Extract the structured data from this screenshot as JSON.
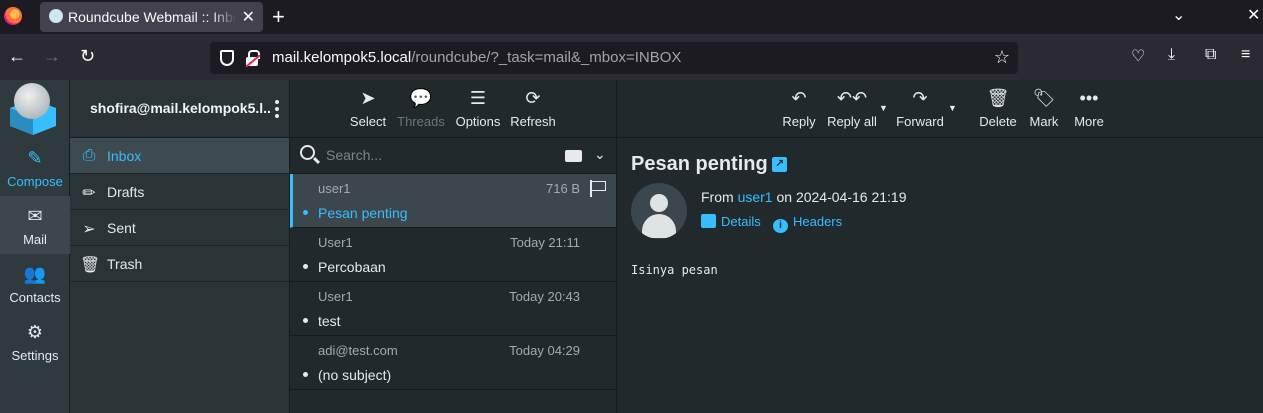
{
  "browser": {
    "tab_title": "Roundcube Webmail :: Inbox",
    "tab_close": "✕",
    "new_tab": "+",
    "url_host": "mail.kelompok5.local",
    "url_path": "/roundcube/?_task=mail&_mbox=INBOX"
  },
  "mainnav": {
    "items": [
      {
        "label": "Compose",
        "icon": "compose-icon"
      },
      {
        "label": "Mail",
        "icon": "envelope-icon"
      },
      {
        "label": "Contacts",
        "icon": "users-icon"
      },
      {
        "label": "Settings",
        "icon": "gear-icon"
      }
    ]
  },
  "account": {
    "email": "shofira@mail.kelompok5.l..."
  },
  "folders": [
    {
      "label": "Inbox",
      "icon": "inbox-icon"
    },
    {
      "label": "Drafts",
      "icon": "pencil-icon"
    },
    {
      "label": "Sent",
      "icon": "paper-plane-icon"
    },
    {
      "label": "Trash",
      "icon": "trash-icon"
    }
  ],
  "list_toolbar": {
    "select": "Select",
    "threads": "Threads",
    "options": "Options",
    "refresh": "Refresh"
  },
  "search": {
    "placeholder": "Search..."
  },
  "messages": [
    {
      "from": "user1",
      "meta": "716 B",
      "subject": "Pesan penting",
      "selected": true
    },
    {
      "from": "User1",
      "meta": "Today 21:11",
      "subject": "Percobaan"
    },
    {
      "from": "User1",
      "meta": "Today 20:43",
      "subject": "test"
    },
    {
      "from": "adi@test.com",
      "meta": "Today 04:29",
      "subject": "(no subject)"
    }
  ],
  "preview_toolbar": {
    "reply": "Reply",
    "reply_all": "Reply all",
    "forward": "Forward",
    "delete": "Delete",
    "mark": "Mark",
    "more": "More"
  },
  "preview": {
    "subject": "Pesan penting",
    "from_prefix": "From",
    "from_name": "user1",
    "date_text": "on 2024-04-16 21:19",
    "details": "Details",
    "headers": "Headers",
    "body": "Isinya pesan"
  },
  "colors": {
    "accent": "#37beff",
    "background": "#21292c"
  }
}
